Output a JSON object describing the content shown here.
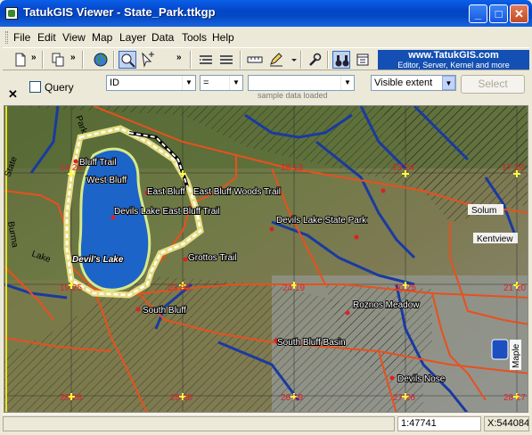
{
  "window": {
    "title": "TatukGIS Viewer - State_Park.ttkgp",
    "minimize": "_",
    "maximize": "□",
    "close": "✕"
  },
  "menu": [
    "File",
    "Edit",
    "View",
    "Map",
    "Layer",
    "Data",
    "Tools",
    "Help"
  ],
  "toolbar": {
    "brand_line1": "www.TatukGIS.com",
    "brand_line2": "Editor, Server, Kernel and more",
    "overflow_glyph": "»"
  },
  "query": {
    "close_glyph": "✕",
    "checkbox_label": "Query",
    "field_value": "ID",
    "operator_value": "=",
    "value_value": "",
    "status_note": "sample data loaded",
    "extent_value": "Visible extent",
    "select_label": "Select"
  },
  "map": {
    "lake_name": "Devil's Lake",
    "road_labels": [
      "Park",
      "State",
      "Burma",
      "Lake",
      "Solum",
      "Kentview",
      "Maple"
    ],
    "place_labels": [
      "Bluff Trail",
      "West Bluff",
      "East Bluff",
      "East Bluff Woods Trail",
      "Devils Lake East Bluff Trail",
      "Devils Lake State Park",
      "Grottos Trail",
      "South Bluff",
      "Roznos Meadow",
      "South Bluff Basin",
      "Devils Nose"
    ],
    "grid_numbers": [
      "14 26",
      "18 13",
      "13 24",
      "17 20",
      "19 25",
      "23 30",
      "24 19",
      "20 25",
      "21 20",
      "28 28",
      "25 30",
      "26 29",
      "27 26",
      "28 27",
      "29 28"
    ]
  },
  "status": {
    "scale": "1:47741",
    "coords": "X:544084"
  },
  "colors": {
    "accent": "#0a5fe8",
    "road": "#e8501e",
    "water": "#1a3aa0",
    "lake": "#1c64c8"
  }
}
